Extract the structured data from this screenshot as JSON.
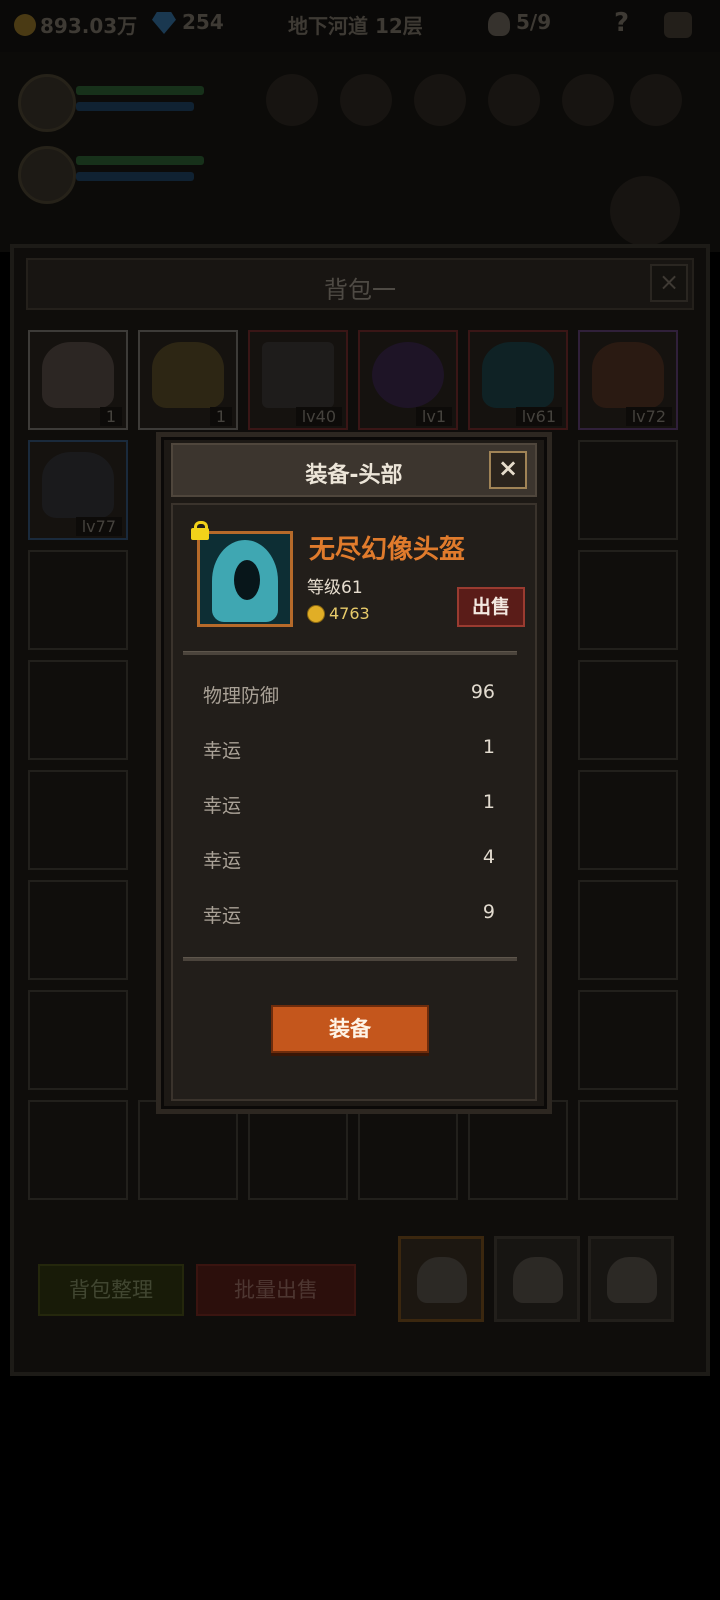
{
  "hud": {
    "gold": "893.03万",
    "gems": "254",
    "location": "地下河道 12层",
    "kills": "5/9",
    "help": "?",
    "icons": [
      "coin-icon",
      "gem-icon",
      "skull-icon",
      "help-icon",
      "settings-icon"
    ]
  },
  "backpack": {
    "title": "背包一",
    "close": "×",
    "slots": [
      {
        "qty": "1",
        "icon": "cake-icon",
        "border": "white"
      },
      {
        "qty": "1",
        "icon": "beer-mug-icon",
        "border": "white"
      },
      {
        "qty": "lv40",
        "icon": "shield-icon",
        "border": "red"
      },
      {
        "qty": "lv1",
        "icon": "ring-icon",
        "border": "red"
      },
      {
        "qty": "lv61",
        "icon": "hood-icon",
        "border": "red"
      },
      {
        "qty": "lv72",
        "icon": "helmet-icon",
        "border": "purple"
      },
      {
        "qty": "lv77",
        "icon": "armor-icon",
        "border": "blue"
      }
    ],
    "sort_button": "背包整理",
    "bulk_sell_button": "批量出售",
    "tabs": [
      "backpack-tab-1",
      "backpack-tab-2",
      "backpack-tab-3"
    ]
  },
  "dialog": {
    "title": "装备-头部",
    "close": "×",
    "item": {
      "name": "无尽幻像头盔",
      "level": "等级61",
      "price": "4763",
      "locked": true,
      "icon": "hood-icon"
    },
    "sell_button": "出售",
    "stats": [
      {
        "label": "物理防御",
        "value": "96"
      },
      {
        "label": "幸运",
        "value": "1"
      },
      {
        "label": "幸运",
        "value": "1"
      },
      {
        "label": "幸运",
        "value": "4"
      },
      {
        "label": "幸运",
        "value": "9"
      }
    ],
    "equip_button": "装备"
  },
  "colors": {
    "item_name": "#e07b2c",
    "equip_button": "#c4561c",
    "sell_button": "#5a1c18",
    "lock": "#f2d21a",
    "coin": "#e1ae26"
  }
}
